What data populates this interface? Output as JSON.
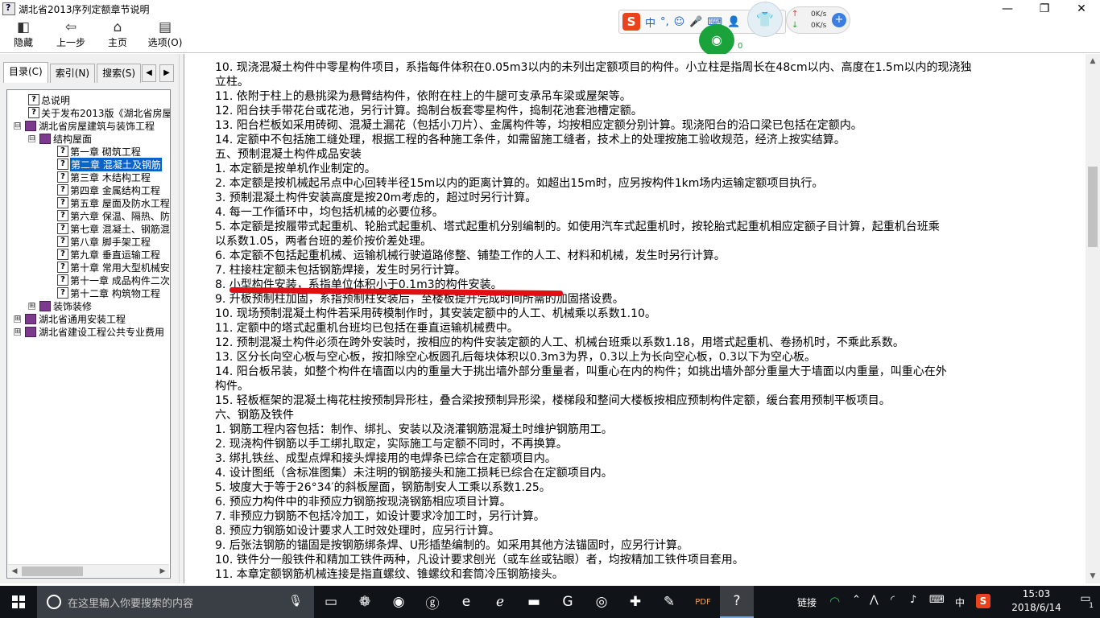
{
  "window": {
    "title": "湖北省2013序列定额章节说明",
    "minimize_glyph": "—",
    "restore_glyph": "❐",
    "close_glyph": "✕"
  },
  "toolbar": {
    "hide_label": "隐藏",
    "back_label": "上一步",
    "home_label": "主页",
    "options_label": "选项(O)"
  },
  "ime": {
    "logo": "S",
    "items": [
      "中",
      "°,",
      "☺",
      "🎤",
      "⌨",
      "👤"
    ],
    "net_up": "0K/s",
    "net_down": "0K/s",
    "wifi_count": "0"
  },
  "tabs": {
    "contents": "目录(C)",
    "index": "索引(N)",
    "search": "搜索(S)",
    "left_arrow": "◀",
    "right_arrow": "▶"
  },
  "tree": [
    {
      "label": "总说明",
      "type": "page",
      "selected": false
    },
    {
      "label": "关于发布2013版《湖北省房屋",
      "type": "page",
      "selected": false
    },
    {
      "label": "湖北省房屋建筑与装饰工程",
      "type": "book",
      "expander": "⊟",
      "selected": false
    },
    {
      "label": "结构屋面",
      "type": "book",
      "expander": "⊟",
      "selected": false
    },
    {
      "label": "第一章 砌筑工程",
      "type": "page",
      "selected": false
    },
    {
      "label": "第二章 混凝土及钢筋",
      "type": "page",
      "selected": true
    },
    {
      "label": "第三章 木结构工程",
      "type": "page",
      "selected": false
    },
    {
      "label": "第四章 金属结构工程",
      "type": "page",
      "selected": false
    },
    {
      "label": "第五章 屋面及防水工程",
      "type": "page",
      "selected": false
    },
    {
      "label": "第六章 保温、隔热、防",
      "type": "page",
      "selected": false
    },
    {
      "label": "第七章 混凝土、钢筋混",
      "type": "page",
      "selected": false
    },
    {
      "label": "第八章 脚手架工程",
      "type": "page",
      "selected": false
    },
    {
      "label": "第九章 垂直运输工程",
      "type": "page",
      "selected": false
    },
    {
      "label": "第十章 常用大型机械安",
      "type": "page",
      "selected": false
    },
    {
      "label": "第十一章 成品构件二次",
      "type": "page",
      "selected": false
    },
    {
      "label": "第十二章 构筑物工程",
      "type": "page",
      "selected": false
    },
    {
      "label": "装饰装修",
      "type": "book",
      "expander": "⊞",
      "selected": false
    },
    {
      "label": "湖北省通用安装工程",
      "type": "book",
      "expander": "⊞",
      "selected": false
    },
    {
      "label": "湖北省建设工程公共专业费用",
      "type": "book",
      "expander": "⊞",
      "selected": false
    }
  ],
  "content_lines": [
    "10. 现浇混凝土构件中零星构件项目，系指每件体积在0.05m3以内的未列出定额项目的构件。小立柱是指周长在48cm以内、高度在1.5m以内的现浇独",
    "立柱。",
    "11. 依附于柱上的悬挑梁为悬臂结构件，依附在柱上的牛腿可支承吊车梁或屋架等。",
    "12. 阳台扶手带花台或花池，另行计算。捣制台板套零星构件，捣制花池套池槽定额。",
    "13. 阳台栏板如采用砖砌、混凝土漏花（包括小刀片）、金属构件等，均按相应定额分别计算。现浇阳台的沿口梁已包括在定额内。",
    "14. 定额中不包括施工缝处理，根据工程的各种施工条件，如需留施工缝者，技术上的处理按施工验收规范，经济上按实结算。",
    "五、预制混凝土构件成品安装",
    "1. 本定额是按单机作业制定的。",
    "2. 本定额是按机械起吊点中心回转半径15m以内的距离计算的。如超出15m时，应另按构件1km场内运输定额项目执行。",
    "3. 预制混凝土构件安装高度是按20m考虑的，超过时另行计算。",
    "4. 每一工作循环中，均包括机械的必要位移。",
    "5. 本定额是按履带式起重机、轮胎式起重机、塔式起重机分别编制的。如使用汽车式起重机时，按轮胎式起重机相应定额子目计算，起重机台班乘",
    "以系数1.05，两者台班的差价按价差处理。",
    "6. 本定额不包括起重机械、运输机械行驶道路修整、铺垫工作的人工、材料和机械，发生时另行计算。",
    "7. 柱接柱定额未包括钢筋焊接，发生时另行计算。",
    "8. 小型构件安装，系指单位体积小于0.1m3的构件安装。",
    "9. 升板预制柱加固，系指预制柱安装后，至楼板提升完成时间所需的加固搭设费。",
    "10. 现场预制混凝土构件若采用砖模制作时，其安装定额中的人工、机械乘以系数1.10。",
    "11. 定额中的塔式起重机台班均已包括在垂直运输机械费中。",
    "12. 预制混凝土构件必须在跨外安装时，按相应的构件安装定额的人工、机械台班乘以系数1.18，用塔式起重机、卷扬机时，不乘此系数。",
    "13. 区分长向空心板与空心板，按扣除空心板圆孔后每块体积以0.3m3为界，0.3以上为长向空心板，0.3以下为空心板。",
    "14. 阳台板吊装，如整个构件在墙面以内的重量大于挑出墙外部分重量者，叫重心在内的构件；如挑出墙外部分重量大于墙面以内重量，叫重心在外",
    "构件。",
    "15. 轻板框架的混凝土梅花柱按预制异形柱，叠合梁按预制异形梁，楼梯段和整间大楼板按相应预制构件定额，缓台套用预制平板项目。",
    "六、钢筋及铁件",
    "1. 钢筋工程内容包括：制作、绑扎、安装以及浇灌钢筋混凝土时维护钢筋用工。",
    "2. 现浇构件钢筋以手工绑扎取定，实际施工与定额不同时，不再换算。",
    "3. 绑扎铁丝、成型点焊和接头焊接用的电焊条已综合在定额项目内。",
    "4. 设计图纸（含标准图集）未注明的钢筋接头和施工损耗已综合在定额项目内。",
    "5. 坡度大于等于26°34′的斜板屋面，钢筋制安人工乘以系数1.25。",
    "6. 预应力构件中的非预应力钢筋按现浇钢筋相应项目计算。",
    "7. 非预应力钢筋不包括冷加工，如设计要求冷加工时，另行计算。",
    "8. 预应力钢筋如设计要求人工时效处理时，应另行计算。",
    "9. 后张法钢筋的锚固是按钢筋绑条焊、U形插垫编制的。如采用其他方法锚固时，应另行计算。",
    "10. 铁件分一般铁件和精加工铁件两种，凡设计要求刨光（或车丝或钻眼）者，均按精加工铁件项目套用。",
    "11. 本章定额钢筋机械连接是指直螺纹、锥螺纹和套筒冷压钢筋接头。"
  ],
  "highlight": {
    "color": "#e10f14",
    "line_number": 15
  },
  "taskbar": {
    "search_placeholder": "在这里输入你要搜索的内容",
    "apps": [
      "▭",
      "❁",
      "◉",
      "ⓖ",
      "e",
      "ℯ",
      "▬",
      "G",
      "◎",
      "✚",
      "✎",
      "PDF",
      "?"
    ],
    "tray_label": "链接",
    "ime_indicator": "中",
    "time": "15:03",
    "date": "2018/6/14",
    "notification_count": "1"
  }
}
